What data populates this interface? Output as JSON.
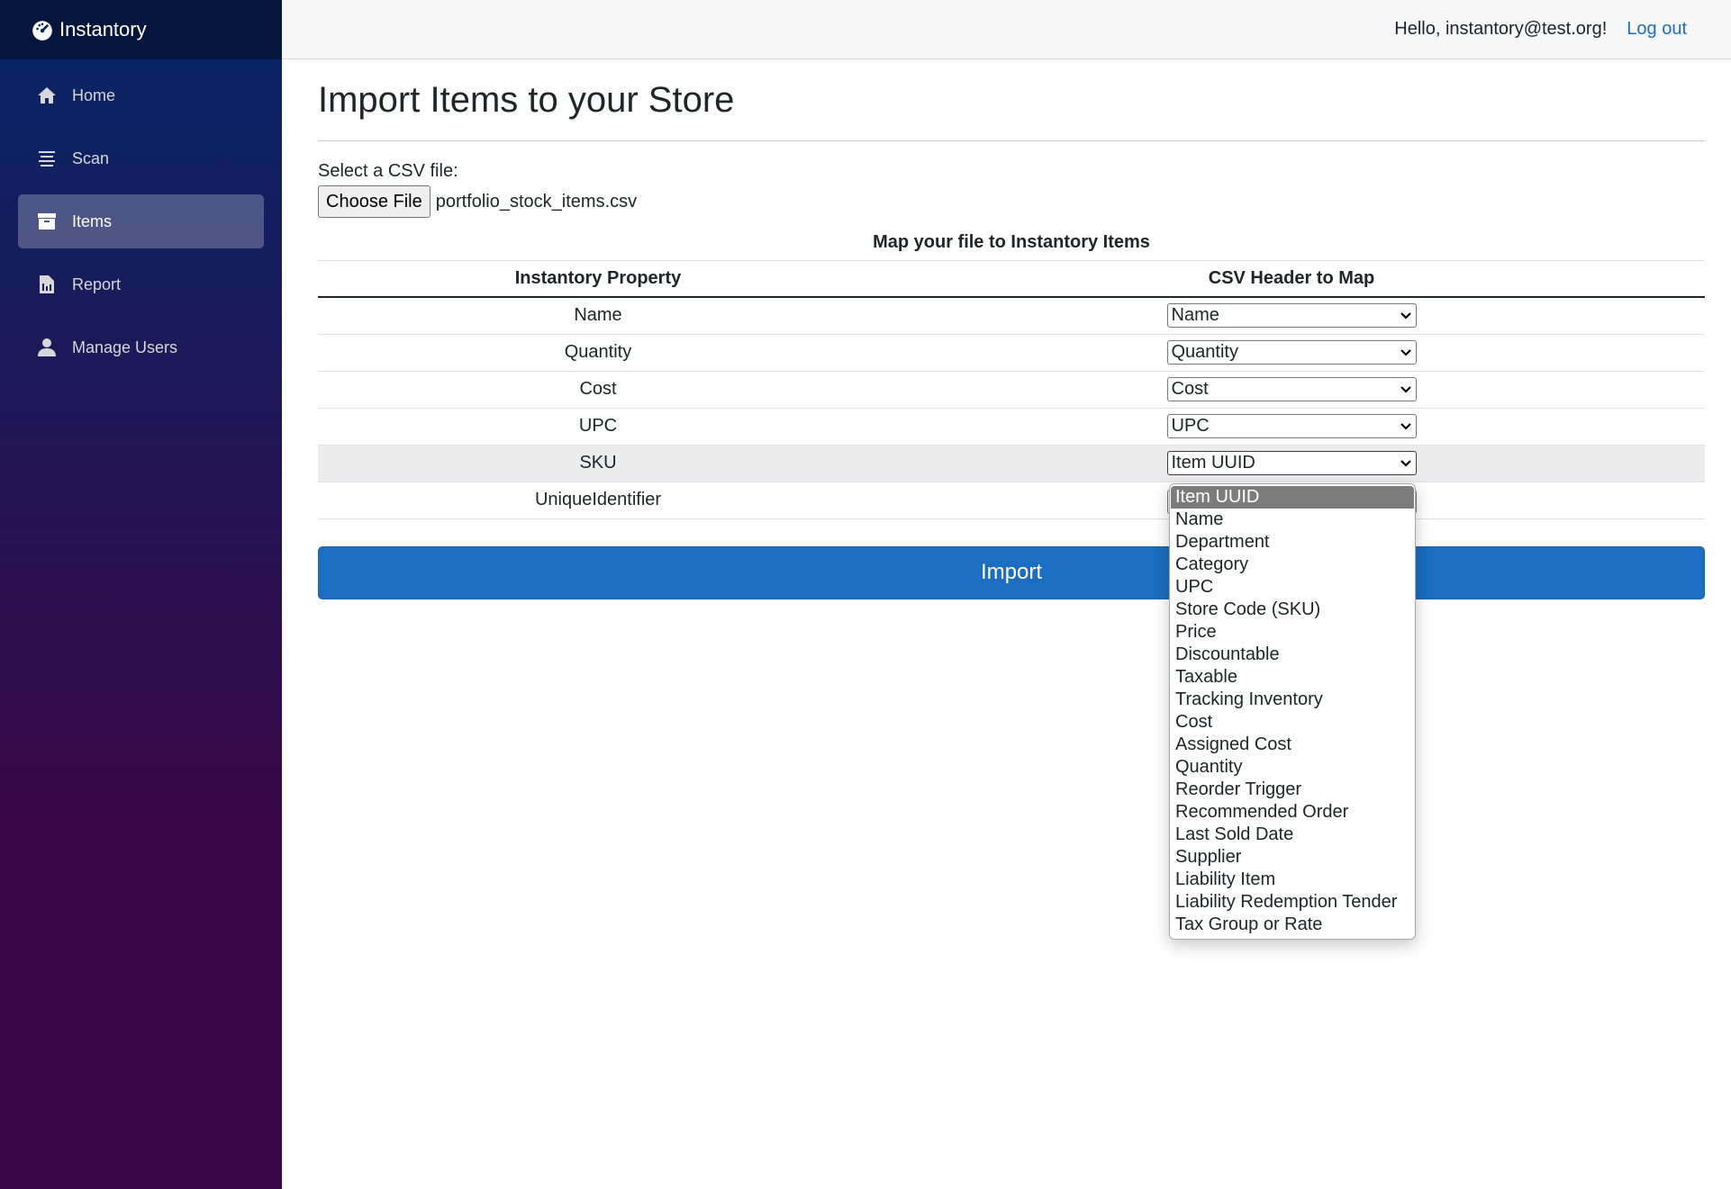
{
  "app": {
    "brand": "Instantory"
  },
  "sidebar": {
    "items": [
      {
        "label": "Home",
        "icon": "home-icon",
        "active": false
      },
      {
        "label": "Scan",
        "icon": "list-icon",
        "active": false
      },
      {
        "label": "Items",
        "icon": "archive-icon",
        "active": true
      },
      {
        "label": "Report",
        "icon": "report-icon",
        "active": false
      },
      {
        "label": "Manage Users",
        "icon": "user-icon",
        "active": false
      }
    ]
  },
  "header": {
    "greeting": "Hello, instantory@test.org!",
    "logout": "Log out"
  },
  "page": {
    "title": "Import Items to your Store",
    "file_label": "Select a CSV file:",
    "choose_file": "Choose File",
    "file_name": "portfolio_stock_items.csv",
    "table_caption": "Map your file to Instantory Items",
    "col_property": "Instantory Property",
    "col_header": "CSV Header to Map",
    "rows": [
      {
        "property": "Name",
        "mapping": "Name"
      },
      {
        "property": "Quantity",
        "mapping": "Quantity"
      },
      {
        "property": "Cost",
        "mapping": "Cost"
      },
      {
        "property": "UPC",
        "mapping": "UPC"
      },
      {
        "property": "SKU",
        "mapping": "Item UUID"
      },
      {
        "property": "UniqueIdentifier",
        "mapping": ""
      }
    ],
    "import_button": "Import"
  },
  "dropdown": {
    "selected": "Item UUID",
    "options": [
      "Item UUID",
      "Name",
      "Department",
      "Category",
      "UPC",
      "Store Code (SKU)",
      "Price",
      "Discountable",
      "Taxable",
      "Tracking Inventory",
      "Cost",
      "Assigned Cost",
      "Quantity",
      "Reorder Trigger",
      "Recommended Order",
      "Last Sold Date",
      "Supplier",
      "Liability Item",
      "Liability Redemption Tender",
      "Tax Group or Rate"
    ]
  },
  "colors": {
    "sidebar_top": "#052767",
    "sidebar_bottom": "#3a0647",
    "primary": "#1b6ec2",
    "link": "#1b6ec2"
  }
}
